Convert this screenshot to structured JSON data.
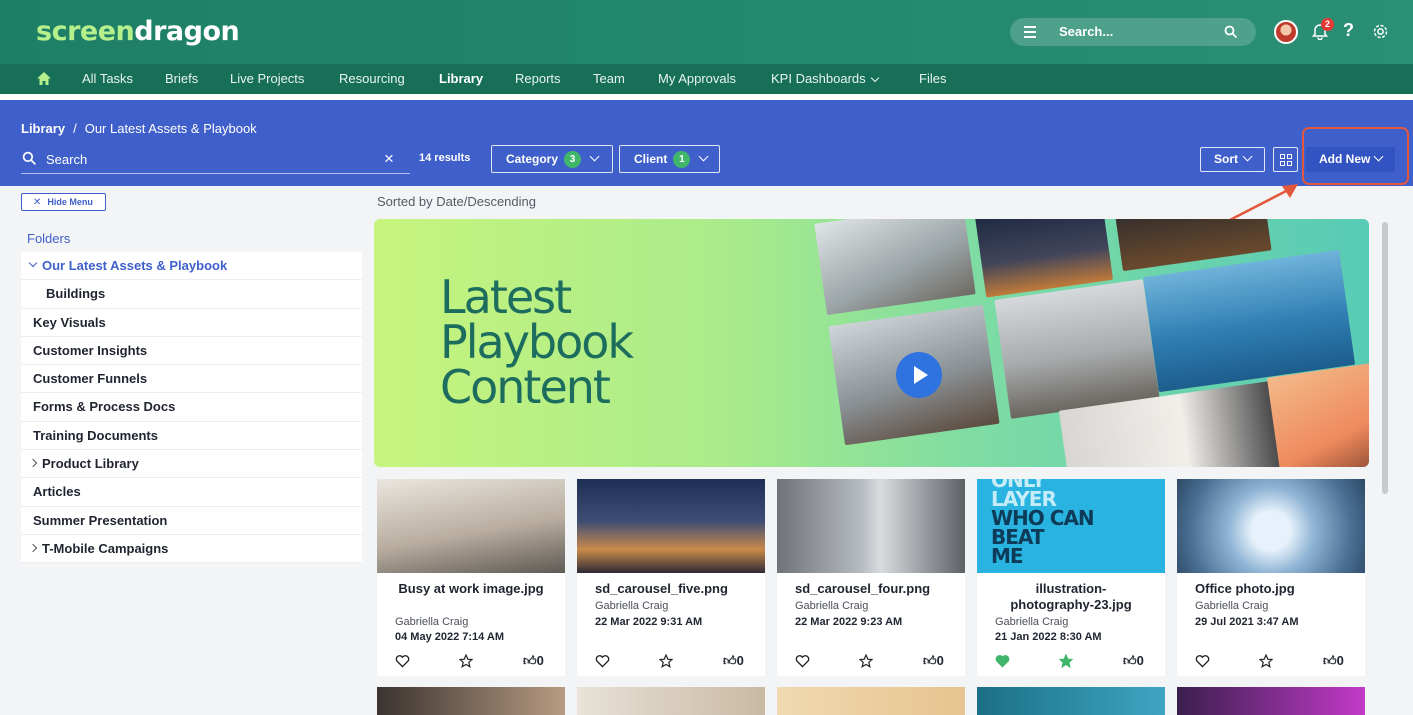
{
  "header": {
    "logo_part1": "screen",
    "logo_part2": "dragon",
    "search_placeholder": "Search...",
    "notification_count": "2",
    "help_label": "?"
  },
  "nav": {
    "items": [
      "All Tasks",
      "Briefs",
      "Live Projects",
      "Resourcing",
      "Library",
      "Reports",
      "Team",
      "My Approvals",
      "KPI Dashboards",
      "Files"
    ],
    "active": "Library"
  },
  "toolbar": {
    "breadcrumb_root": "Library",
    "breadcrumb_sep": "/",
    "breadcrumb_current": "Our Latest Assets & Playbook",
    "search_placeholder": "Search",
    "clear_icon": "×",
    "results": "14 results",
    "category_label": "Category",
    "category_count": "3",
    "client_label": "Client",
    "client_count": "1",
    "sort_label": "Sort",
    "add_new_label": "Add New"
  },
  "sidebar": {
    "hide_menu_label": "Hide Menu",
    "folders_heading": "Folders",
    "folders": [
      {
        "label": "Our Latest Assets & Playbook",
        "state": "expanded-selected"
      },
      {
        "label": "Buildings",
        "state": "child"
      },
      {
        "label": "Key Visuals",
        "state": "plain"
      },
      {
        "label": "Customer Insights",
        "state": "plain"
      },
      {
        "label": "Customer Funnels",
        "state": "plain"
      },
      {
        "label": "Forms & Process Docs",
        "state": "plain"
      },
      {
        "label": "Training Documents",
        "state": "plain"
      },
      {
        "label": "Product Library",
        "state": "collapsed"
      },
      {
        "label": "Articles",
        "state": "plain"
      },
      {
        "label": "Summer Presentation",
        "state": "plain"
      },
      {
        "label": "T-Mobile Campaigns",
        "state": "collapsed"
      }
    ]
  },
  "main": {
    "sorted_label": "Sorted by Date/Descending",
    "hero_lines": [
      "Latest",
      "Playbook",
      "Content"
    ],
    "cards": [
      {
        "name": "Busy at work image.jpg",
        "author": "Gabriella Craig",
        "date": "04 May 2022 7:14 AM",
        "likes": "0",
        "favorited": false,
        "starred": false
      },
      {
        "name": "sd_carousel_five.png",
        "author": "Gabriella Craig",
        "date": "22 Mar 2022 9:31 AM",
        "likes": "0",
        "favorited": false,
        "starred": false
      },
      {
        "name": "sd_carousel_four.png",
        "author": "Gabriella Craig",
        "date": "22 Mar 2022 9:23 AM",
        "likes": "0",
        "favorited": false,
        "starred": false
      },
      {
        "name": "illustration-photography-23.jpg",
        "author": "Gabriella Craig",
        "date": "21 Jan 2022 8:30 AM",
        "likes": "0",
        "favorited": true,
        "starred": true
      },
      {
        "name": "Office photo.jpg",
        "author": "Gabriella Craig",
        "date": "29 Jul 2021 3:47 AM",
        "likes": "0",
        "favorited": false,
        "starred": false
      }
    ],
    "card_image_text": {
      "illustration": [
        "ONLY",
        "LAYER",
        "WHO CAN",
        "BEAT",
        "ME"
      ]
    }
  },
  "colors": {
    "header_green": "#1e7f66",
    "nav_green": "#176f57",
    "toolbar_blue": "#3f5fcb",
    "accent_green": "#3fb66a",
    "highlight_red": "#e3583c"
  }
}
